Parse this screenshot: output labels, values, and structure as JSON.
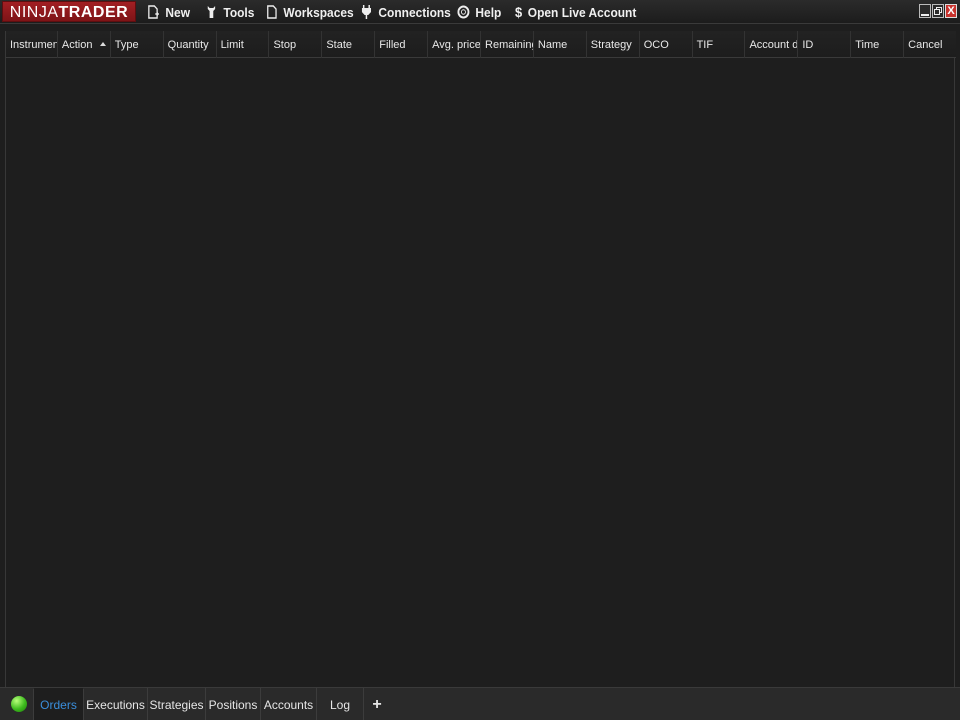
{
  "app": {
    "logo_part1": "NINJA",
    "logo_part2": "TRADER",
    "brand_color": "#a21f23"
  },
  "menu": [
    {
      "label": "New",
      "icon": "new-document-icon"
    },
    {
      "label": "Tools",
      "icon": "wrench-icon"
    },
    {
      "label": "Workspaces",
      "icon": "document-icon"
    },
    {
      "label": "Connections",
      "icon": "plug-icon"
    },
    {
      "label": "Help",
      "icon": "lifebuoy-icon"
    },
    {
      "label": "Open Live Account",
      "icon": "dollar-icon"
    }
  ],
  "window_controls": {
    "close_glyph": "X"
  },
  "grid": {
    "columns": [
      "Instrument",
      "Action",
      "Type",
      "Quantity",
      "Limit",
      "Stop",
      "State",
      "Filled",
      "Avg. price",
      "Remaining",
      "Name",
      "Strategy",
      "OCO",
      "TIF",
      "Account dis",
      "ID",
      "Time",
      "Cancel"
    ],
    "sorted_column": "Action",
    "sort_direction": "ascending",
    "rows": []
  },
  "tabs": {
    "connection_status_color": "#3dbb1e",
    "items": [
      "Orders",
      "Executions",
      "Strategies",
      "Positions",
      "Accounts",
      "Log"
    ],
    "active": "Orders",
    "add_label": "+",
    "active_color": "#3a8edb"
  }
}
